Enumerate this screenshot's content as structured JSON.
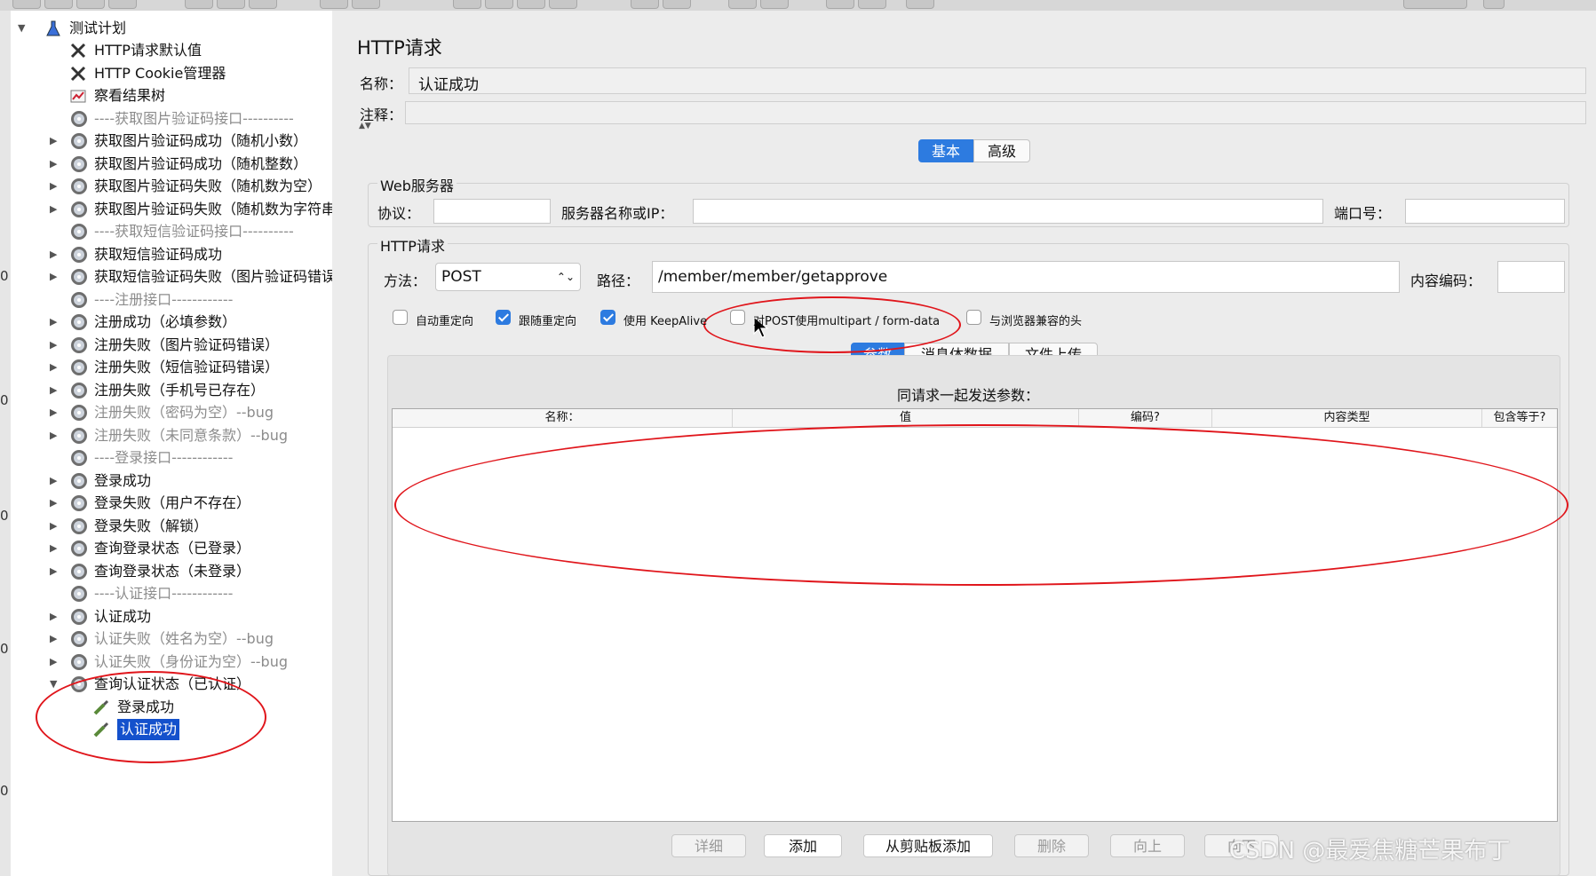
{
  "tree": {
    "root": "测试计划",
    "items": [
      {
        "label": "HTTP请求默认值",
        "icon": "wrench-icon",
        "state": "normal",
        "expand": false
      },
      {
        "label": "HTTP Cookie管理器",
        "icon": "wrench-icon",
        "state": "normal",
        "expand": false
      },
      {
        "label": "察看结果树",
        "icon": "chart-icon",
        "state": "normal",
        "expand": false
      },
      {
        "label": "----获取图片验证码接口----------",
        "icon": "gear-icon",
        "state": "disabled",
        "expand": false
      },
      {
        "label": "获取图片验证码成功（随机小数）",
        "icon": "gear-icon",
        "state": "normal",
        "expand": true
      },
      {
        "label": "获取图片验证码成功（随机整数）",
        "icon": "gear-icon",
        "state": "normal",
        "expand": true
      },
      {
        "label": "获取图片验证码失败（随机数为空）",
        "icon": "gear-icon",
        "state": "normal",
        "expand": true
      },
      {
        "label": "获取图片验证码失败（随机数为字符串",
        "icon": "gear-icon",
        "state": "normal",
        "expand": true
      },
      {
        "label": "----获取短信验证码接口----------",
        "icon": "gear-icon",
        "state": "disabled",
        "expand": false
      },
      {
        "label": "获取短信验证码成功",
        "icon": "gear-icon",
        "state": "normal",
        "expand": true
      },
      {
        "label": "获取短信验证码失败（图片验证码错误",
        "icon": "gear-icon",
        "state": "normal",
        "expand": true
      },
      {
        "label": "----注册接口------------",
        "icon": "gear-icon",
        "state": "disabled",
        "expand": false
      },
      {
        "label": "注册成功（必填参数）",
        "icon": "gear-icon",
        "state": "normal",
        "expand": true
      },
      {
        "label": "注册失败（图片验证码错误）",
        "icon": "gear-icon",
        "state": "normal",
        "expand": true
      },
      {
        "label": "注册失败（短信验证码错误）",
        "icon": "gear-icon",
        "state": "normal",
        "expand": true
      },
      {
        "label": "注册失败（手机号已存在）",
        "icon": "gear-icon",
        "state": "normal",
        "expand": true
      },
      {
        "label": "注册失败（密码为空）--bug",
        "icon": "gear-icon",
        "state": "disabled",
        "expand": true
      },
      {
        "label": "注册失败（未同意条款）--bug",
        "icon": "gear-icon",
        "state": "disabled",
        "expand": true
      },
      {
        "label": "----登录接口------------",
        "icon": "gear-icon",
        "state": "disabled",
        "expand": false
      },
      {
        "label": "登录成功",
        "icon": "gear-icon",
        "state": "normal",
        "expand": true
      },
      {
        "label": "登录失败（用户不存在）",
        "icon": "gear-icon",
        "state": "normal",
        "expand": true
      },
      {
        "label": "登录失败（解锁）",
        "icon": "gear-icon",
        "state": "normal",
        "expand": true
      },
      {
        "label": "查询登录状态（已登录）",
        "icon": "gear-icon",
        "state": "normal",
        "expand": true
      },
      {
        "label": "查询登录状态（未登录）",
        "icon": "gear-icon",
        "state": "normal",
        "expand": true
      },
      {
        "label": "----认证接口------------",
        "icon": "gear-icon",
        "state": "disabled",
        "expand": false
      },
      {
        "label": "认证成功",
        "icon": "gear-icon",
        "state": "normal",
        "expand": true
      },
      {
        "label": "认证失败（姓名为空）--bug",
        "icon": "gear-icon",
        "state": "disabled",
        "expand": true
      },
      {
        "label": "认证失败（身份证为空）--bug",
        "icon": "gear-icon",
        "state": "disabled",
        "expand": true
      },
      {
        "label": "查询认证状态（已认证）",
        "icon": "gear-icon",
        "state": "normal",
        "expand": "open"
      }
    ],
    "children": [
      {
        "label": "登录成功",
        "icon": "sampler-pipette-icon",
        "selected": false
      },
      {
        "label": "认证成功",
        "icon": "sampler-pipette-icon",
        "selected": true
      }
    ]
  },
  "panel": {
    "title": "HTTP请求",
    "name_label": "名称：",
    "name_value": "认证成功",
    "comment_label": "注释：",
    "tabs": [
      "基本",
      "高级"
    ],
    "web_server": {
      "group_title": "Web服务器",
      "protocol_label": "协议：",
      "server_label": "服务器名称或IP：",
      "port_label": "端口号："
    },
    "http_request": {
      "group_title": "HTTP请求",
      "method_label": "方法：",
      "method_value": "POST",
      "path_label": "路径：",
      "path_value": "/member/member/getapprove",
      "encoding_label": "内容编码："
    },
    "checkboxes": [
      {
        "label": "自动重定向",
        "checked": false
      },
      {
        "label": "跟随重定向",
        "checked": true
      },
      {
        "label": "使用 KeepAlive",
        "checked": true
      },
      {
        "label": "对POST使用multipart / form-data",
        "checked": false
      },
      {
        "label": "与浏览器兼容的头",
        "checked": false
      }
    ],
    "subtabs": [
      "参数",
      "消息体数据",
      "文件上传"
    ],
    "params_title": "同请求一起发送参数：",
    "columns": [
      "名称：",
      "值",
      "编码?",
      "内容类型",
      "包含等于?"
    ],
    "buttons": [
      {
        "label": "详细",
        "enabled": false
      },
      {
        "label": "添加",
        "enabled": true
      },
      {
        "label": "从剪贴板添加",
        "enabled": true
      },
      {
        "label": "删除",
        "enabled": false
      },
      {
        "label": "向上",
        "enabled": false
      },
      {
        "label": "向下",
        "enabled": false
      }
    ]
  },
  "gutter_digits": [
    "0",
    "0",
    "0",
    "0",
    "0",
    "0"
  ],
  "watermark": "CSDN @最爱焦糖芒果布丁",
  "colors": {
    "accent": "#2d7be0",
    "selection": "#1451cc",
    "annotation": "#e0151b"
  }
}
